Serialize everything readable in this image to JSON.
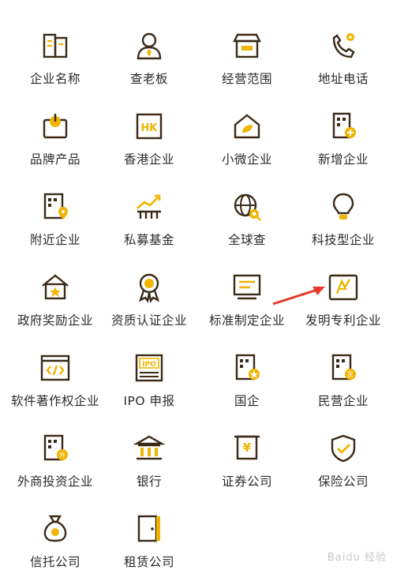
{
  "accent": "#f1b400",
  "stroke": "#3a2a17",
  "items": [
    {
      "label": "企业名称",
      "icon": "building-doc-icon"
    },
    {
      "label": "查老板",
      "icon": "person-icon"
    },
    {
      "label": "经营范围",
      "icon": "storefront-icon"
    },
    {
      "label": "地址电话",
      "icon": "phone-location-icon"
    },
    {
      "label": "品牌产品",
      "icon": "brand-box-icon"
    },
    {
      "label": "香港企业",
      "icon": "hk-icon"
    },
    {
      "label": "小微企业",
      "icon": "house-leaf-icon"
    },
    {
      "label": "新增企业",
      "icon": "building-plus-icon"
    },
    {
      "label": "附近企业",
      "icon": "building-location-icon"
    },
    {
      "label": "私募基金",
      "icon": "trend-chart-icon"
    },
    {
      "label": "全球查",
      "icon": "globe-search-icon"
    },
    {
      "label": "科技型企业",
      "icon": "lightbulb-icon"
    },
    {
      "label": "政府奖励企业",
      "icon": "house-star-icon"
    },
    {
      "label": "资质认证企业",
      "icon": "medal-icon"
    },
    {
      "label": "标准制定企业",
      "icon": "monitor-lines-icon"
    },
    {
      "label": "发明专利企业",
      "icon": "patent-icon"
    },
    {
      "label": "软件著作权企业",
      "icon": "code-window-icon"
    },
    {
      "label": "IPO 申报",
      "icon": "ipo-icon"
    },
    {
      "label": "国企",
      "icon": "building-star-icon"
    },
    {
      "label": "民营企业",
      "icon": "building-min-icon"
    },
    {
      "label": "外商投资企业",
      "icon": "building-foreign-icon"
    },
    {
      "label": "银行",
      "icon": "bank-icon"
    },
    {
      "label": "证券公司",
      "icon": "yen-board-icon"
    },
    {
      "label": "保险公司",
      "icon": "shield-check-icon"
    },
    {
      "label": "信托公司",
      "icon": "money-bag-icon"
    },
    {
      "label": "租赁公司",
      "icon": "door-icon"
    }
  ],
  "watermark": "Baidu 经验"
}
